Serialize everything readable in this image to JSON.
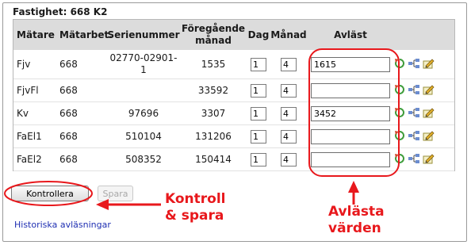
{
  "panel": {
    "title": "Fastighet: 668 K2"
  },
  "table": {
    "headers": {
      "meter": "Mätare",
      "meter_area": "Mätarbet.",
      "serial": "Serienummer",
      "previous_line1": "Föregående",
      "previous_line2": "månad",
      "day": "Dag",
      "month": "Månad",
      "read": "Avläst"
    },
    "rows": [
      {
        "meter": "Fjv",
        "area": "668",
        "serial_line1": "02770-02901-",
        "serial_line2": "1",
        "previous": "1535",
        "day": "1",
        "month": "4",
        "read": "1615"
      },
      {
        "meter": "FjvFl",
        "area": "668",
        "serial_line1": "",
        "serial_line2": "",
        "previous": "33592",
        "day": "1",
        "month": "4",
        "read": ""
      },
      {
        "meter": "Kv",
        "area": "668",
        "serial_line1": "97696",
        "serial_line2": "",
        "previous": "3307",
        "day": "1",
        "month": "4",
        "read": "3452"
      },
      {
        "meter": "FaEl1",
        "area": "668",
        "serial_line1": "510104",
        "serial_line2": "",
        "previous": "131206",
        "day": "1",
        "month": "4",
        "read": ""
      },
      {
        "meter": "FaEl2",
        "area": "668",
        "serial_line1": "508352",
        "serial_line2": "",
        "previous": "150414",
        "day": "1",
        "month": "4",
        "read": ""
      }
    ],
    "row_icons": [
      "refresh-icon",
      "tree-icon",
      "edit-icon"
    ]
  },
  "buttons": {
    "check": "Kontrollera",
    "save": "Spara"
  },
  "links": {
    "history": "Historiska avläsningar"
  },
  "annotations": {
    "control_line1": "Kontroll",
    "control_line2": "& spara",
    "read_line1": "Avlästa",
    "read_line2": "värden"
  },
  "colors": {
    "annotation": "#e8181c",
    "header_bg": "#dcdcdc",
    "link": "#1f2fb2"
  }
}
